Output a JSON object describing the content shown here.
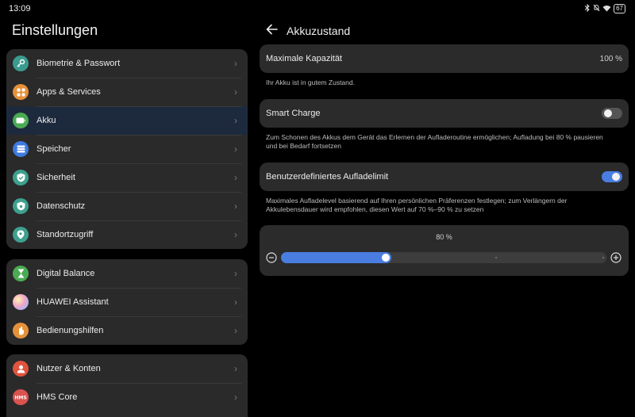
{
  "status": {
    "time": "13:09",
    "battery": "67"
  },
  "left": {
    "title": "Einstellungen",
    "groups": [
      {
        "items": [
          {
            "label": "Biometrie & Passwort",
            "icon": "key-icon",
            "color": "#3b9b8f"
          },
          {
            "label": "Apps & Services",
            "icon": "apps-icon",
            "color": "#e6913a"
          },
          {
            "label": "Akku",
            "icon": "battery-icon",
            "color": "#4bab53"
          },
          {
            "label": "Speicher",
            "icon": "storage-icon",
            "color": "#3f7ae0"
          },
          {
            "label": "Sicherheit",
            "icon": "shield-check-icon",
            "color": "#3ea08e"
          },
          {
            "label": "Datenschutz",
            "icon": "privacy-shield-icon",
            "color": "#3ea08e"
          },
          {
            "label": "Standortzugriff",
            "icon": "location-pin-icon",
            "color": "#3ea08e"
          }
        ]
      },
      {
        "items": [
          {
            "label": "Digital Balance",
            "icon": "hourglass-icon",
            "color": "#4bab53"
          },
          {
            "label": "HUAWEI Assistant",
            "icon": "assistant-orb-icon",
            "color": "#d7a3e8"
          },
          {
            "label": "Bedienungshilfen",
            "icon": "hand-icon",
            "color": "#e6913a"
          }
        ]
      },
      {
        "items": [
          {
            "label": "Nutzer & Konten",
            "icon": "user-icon",
            "color": "#e0533f"
          },
          {
            "label": "HMS Core",
            "icon": "hms-icon",
            "color": "#d9534f"
          }
        ]
      }
    ]
  },
  "right": {
    "title": "Akkuzustand",
    "capacity": {
      "label": "Maximale Kapazität",
      "value": "100 %"
    },
    "capacity_note": "Ihr Akku ist in gutem Zustand.",
    "smart_charge": {
      "label": "Smart Charge",
      "enabled": false
    },
    "smart_charge_note": "Zum Schonen des Akkus dem Gerät das Erlernen der Aufladeroutine ermöglichen; Aufladung bei 80 % pausieren und bei Bedarf fortsetzen",
    "custom_limit": {
      "label": "Benutzerdefiniertes Aufladelimit",
      "enabled": true
    },
    "custom_limit_note": "Maximales Aufladelevel basierend auf Ihren persönlichen Präferenzen festlegen; zum Verlängern der Akkulebensdauer wird empfohlen, diesen Wert auf 70 %–90 % zu setzen",
    "slider": {
      "label": "80 %",
      "value": 80,
      "min": 0,
      "max": 100,
      "fill_fraction": 0.34
    }
  },
  "colors": {
    "accent": "#4a7de0"
  }
}
